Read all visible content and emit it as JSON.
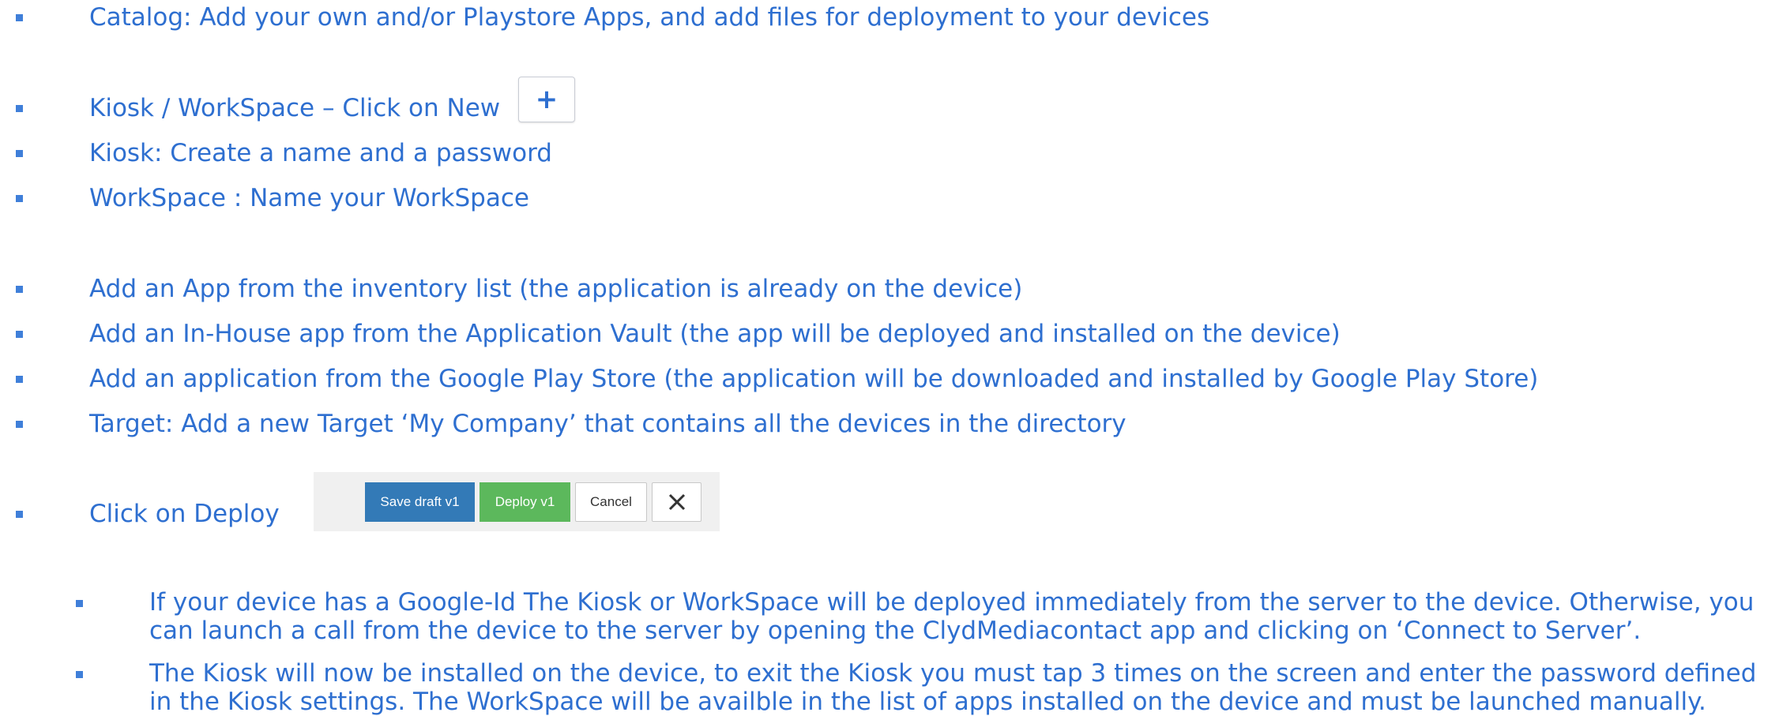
{
  "bullets": [
    "Catalog: Add your own and/or Playstore Apps,  and add files for deployment to your devices",
    "Kiosk / WorkSpace – Click on New",
    "Kiosk: Create a name and a password",
    "WorkSpace : Name your WorkSpace",
    "Add an App from the inventory list (the application is already on the device)",
    "Add an In-House app from the Application Vault (the app will be deployed and installed on the device)",
    "Add an application from the Google Play Store (the application will be downloaded and installed by Google Play Store)",
    "Target: Add a new Target ‘My Company’ that contains all the devices in the directory",
    "Click on Deploy"
  ],
  "new_button": {
    "icon": "plus-icon",
    "glyph": "+"
  },
  "toolbar": {
    "save_label": "Save draft v1",
    "deploy_label": "Deploy v1",
    "cancel_label": "Cancel",
    "close_icon": "close-icon",
    "close_glyph": "✕",
    "colors": {
      "save": "#337ab7",
      "deploy": "#5cb85c"
    }
  },
  "sub_bullets": [
    "If your device has a Google-Id The Kiosk or WorkSpace will be deployed immediately from the server to the device. Otherwise, you can launch a call from the device to the server by opening the ClydMediacontact app and clicking on ‘Connect to Server’.",
    "The Kiosk will now be installed on the device, to exit the Kiosk you must tap 3 times on the screen and enter the password defined in the Kiosk settings. The WorkSpace will be availble in the list of apps installed on the device and must be launched manually."
  ]
}
